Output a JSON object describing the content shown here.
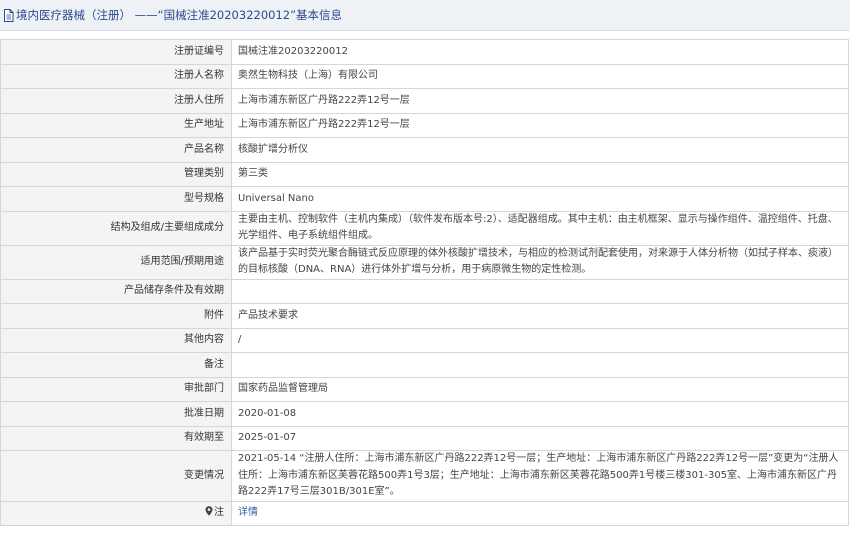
{
  "header": {
    "title": "境内医疗器械（注册） ——“国械注准20203220012”基本信息"
  },
  "rows": [
    {
      "label": "注册证编号",
      "value": "国械注准20203220012"
    },
    {
      "label": "注册人名称",
      "value": "奥然生物科技（上海）有限公司"
    },
    {
      "label": "注册人住所",
      "value": "上海市浦东新区广丹路222弄12号一层"
    },
    {
      "label": "生产地址",
      "value": "上海市浦东新区广丹路222弄12号一层"
    },
    {
      "label": "产品名称",
      "value": "核酸扩增分析仪"
    },
    {
      "label": "管理类别",
      "value": "第三类"
    },
    {
      "label": "型号规格",
      "value": "Universal Nano"
    },
    {
      "label": "结构及组成/主要组成成分",
      "value": "主要由主机、控制软件（主机内集成）（软件发布版本号:2）、适配器组成。其中主机：由主机框架、显示与操作组件、温控组件、托盘、光学组件、电子系统组件组成。"
    },
    {
      "label": "适用范围/预期用途",
      "value": "该产品基于实时荧光聚合酶链式反应原理的体外核酸扩增技术，与相应的检测试剂配套使用，对来源于人体分析物（如拭子样本、痰液）的目标核酸（DNA、RNA）进行体外扩增与分析，用于病原微生物的定性检测。"
    },
    {
      "label": "产品储存条件及有效期",
      "value": ""
    },
    {
      "label": "附件",
      "value": "产品技术要求"
    },
    {
      "label": "其他内容",
      "value": "/"
    },
    {
      "label": "备注",
      "value": ""
    },
    {
      "label": "审批部门",
      "value": "国家药品监督管理局"
    },
    {
      "label": "批准日期",
      "value": "2020-01-08"
    },
    {
      "label": "有效期至",
      "value": "2025-01-07"
    },
    {
      "label": "变更情况",
      "value": "2021-05-14 “注册人住所：上海市浦东新区广丹路222弄12号一层；生产地址：上海市浦东新区广丹路222弄12号一层”变更为“注册人住所：上海市浦东新区芙蓉花路500弄1号3层；生产地址：上海市浦东新区芙蓉花路500弄1号楼三楼301-305室、上海市浦东新区广丹路222弄17号三层301B/301E室”。"
    }
  ],
  "note_row": {
    "label": "注",
    "link": "详情"
  }
}
